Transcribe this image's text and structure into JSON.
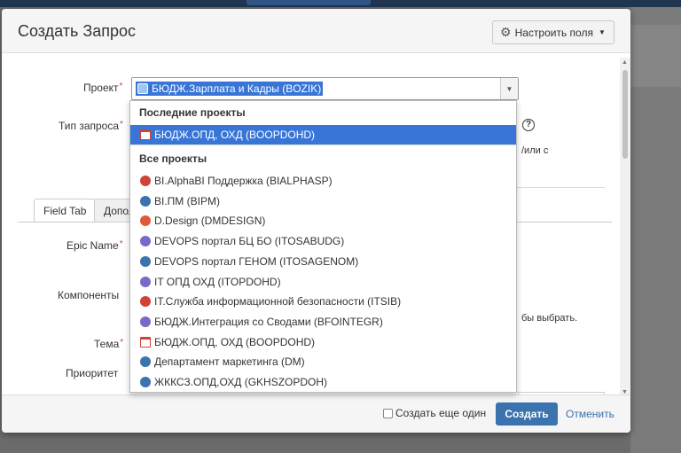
{
  "dialog": {
    "title": "Создать Запрос",
    "config_button": "Настроить поля"
  },
  "form": {
    "project_label": "Проект",
    "request_type_label": "Тип запроса",
    "hint_fragment": "/или с",
    "hint_fragment2": "бы выбрать.",
    "tabs": [
      {
        "label": "Field Tab"
      },
      {
        "label": "Дополнительно"
      }
    ],
    "epic_name_label": "Epic Name",
    "components_label": "Компоненты",
    "summary_label": "Тема",
    "priority_label": "Приоритет"
  },
  "project_select": {
    "value": "БЮДЖ.Зарплата и Кадры (BOZIK)"
  },
  "dropdown": {
    "recent_header": "Последние проекты",
    "recent": [
      {
        "label": "БЮДЖ.ОПД, ОХД (BOOPDOHD)",
        "icon": "calendar-icon",
        "color": "#d04437"
      }
    ],
    "all_header": "Все проекты",
    "all": [
      {
        "label": "BI.AlphaBI Поддержка (BIALPHASP)",
        "icon": "alpha-icon",
        "color": "#d04437"
      },
      {
        "label": "BI.ПМ (BIPM)",
        "icon": "globe-icon",
        "color": "#3b73af"
      },
      {
        "label": "D.Design (DMDESIGN)",
        "icon": "design-icon",
        "color": "#e05a3a"
      },
      {
        "label": "DEVOPS портал БЦ БО (ITOSABUDG)",
        "icon": "rocket-icon",
        "color": "#7b68c8"
      },
      {
        "label": "DEVOPS портал ГЕНОМ (ITOSAGENOM)",
        "icon": "globe-icon",
        "color": "#3b73af"
      },
      {
        "label": "IT ОПД ОХД (ITOPDOHD)",
        "icon": "rocket-icon",
        "color": "#7b68c8"
      },
      {
        "label": "IT.Служба информационной безопасности (ITSIB)",
        "icon": "alpha-icon",
        "color": "#d04437"
      },
      {
        "label": "БЮДЖ.Интеграция со Сводами (BFOINTEGR)",
        "icon": "rocket-icon",
        "color": "#7b68c8"
      },
      {
        "label": "БЮДЖ.ОПД, ОХД (BOOPDOHD)",
        "icon": "calendar-icon",
        "color": "#d04437"
      },
      {
        "label": "Департамент маркетинга (DM)",
        "icon": "globe-icon",
        "color": "#3b73af"
      },
      {
        "label": "ЖККСЗ.ОПД,ОХД (GKHSZOPDOH)",
        "icon": "globe-icon",
        "color": "#3b73af"
      }
    ]
  },
  "footer": {
    "create_another_label": "Создать еще один",
    "create_button": "Создать",
    "cancel_link": "Отменить"
  }
}
